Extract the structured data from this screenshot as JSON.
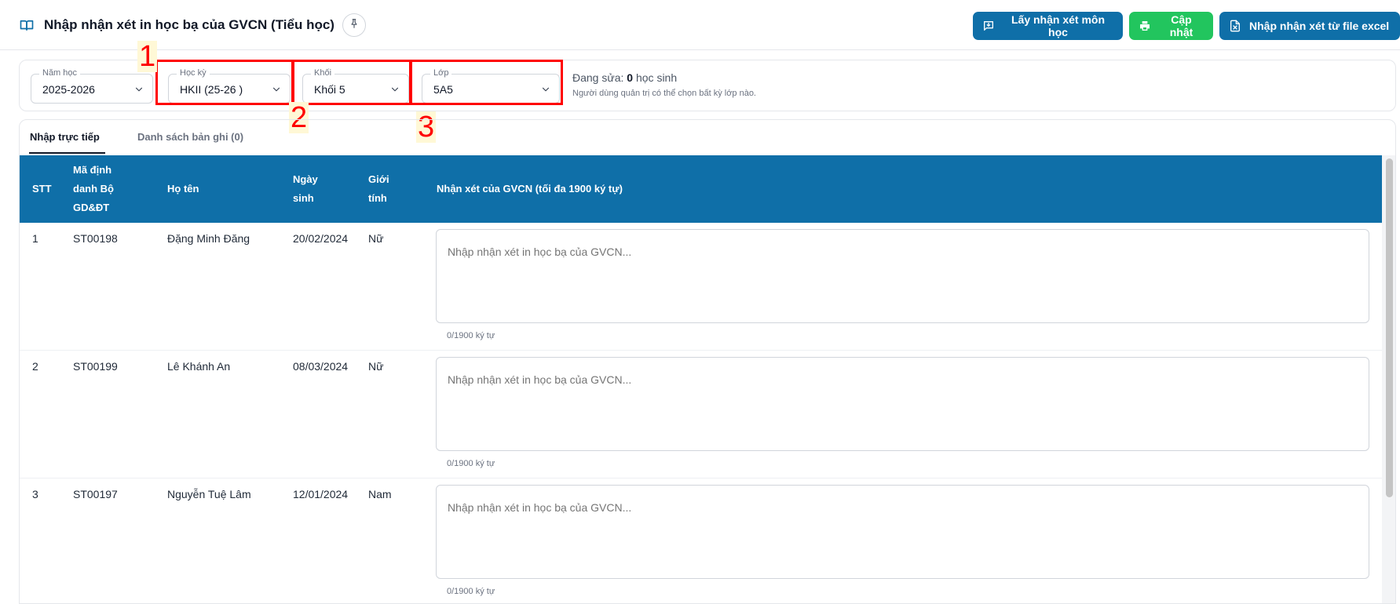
{
  "header": {
    "title": "Nhập nhận xét in học bạ của GVCN (Tiểu học)",
    "actions": {
      "get_comments": "Lấy nhận xét môn học",
      "update": "Cập nhật",
      "import_excel": "Nhập nhận xét từ file excel"
    }
  },
  "filters": {
    "school_year": {
      "label": "Năm học",
      "value": "2025-2026"
    },
    "semester": {
      "label": "Học kỳ",
      "value": "HKII (25-26 )"
    },
    "grade": {
      "label": "Khối",
      "value": "Khối 5"
    },
    "class": {
      "label": "Lớp",
      "value": "5A5"
    },
    "editing_prefix": "Đang sửa:",
    "editing_count": "0",
    "editing_suffix": "học sinh",
    "admin_note": "Người dùng quản trị có thể chọn bất kỳ lớp nào."
  },
  "annotations": [
    "1",
    "2",
    "3"
  ],
  "tabs": [
    {
      "label": "Nhập trực tiếp",
      "active": true
    },
    {
      "label": "Danh sách bản ghi (0)",
      "active": false
    }
  ],
  "table": {
    "headers": {
      "stt": "STT",
      "id_line1": "Mã định",
      "id_line2": "danh Bộ",
      "id_line3": "GD&ĐT",
      "name": "Họ tên",
      "dob_line1": "Ngày",
      "dob_line2": "sinh",
      "gender_line1": "Giới",
      "gender_line2": "tính",
      "comment": "Nhận xét của GVCN (tối đa 1900 ký tự)"
    },
    "comment_placeholder": "Nhập nhận xét in học bạ của GVCN...",
    "rows": [
      {
        "stt": "1",
        "id": "ST00198",
        "name": "Đặng Minh Đăng",
        "dob": "20/02/2024",
        "gender": "Nữ",
        "counter": "0/1900 ký tự"
      },
      {
        "stt": "2",
        "id": "ST00199",
        "name": "Lê Khánh An",
        "dob": "08/03/2024",
        "gender": "Nữ",
        "counter": "0/1900 ký tự"
      },
      {
        "stt": "3",
        "id": "ST00197",
        "name": "Nguyễn Tuệ Lâm",
        "dob": "12/01/2024",
        "gender": "Nam",
        "counter": "0/1900 ký tự"
      }
    ]
  },
  "colors": {
    "primary": "#0f6fa8",
    "success": "#22c55e",
    "annotation": "#ff0000"
  }
}
